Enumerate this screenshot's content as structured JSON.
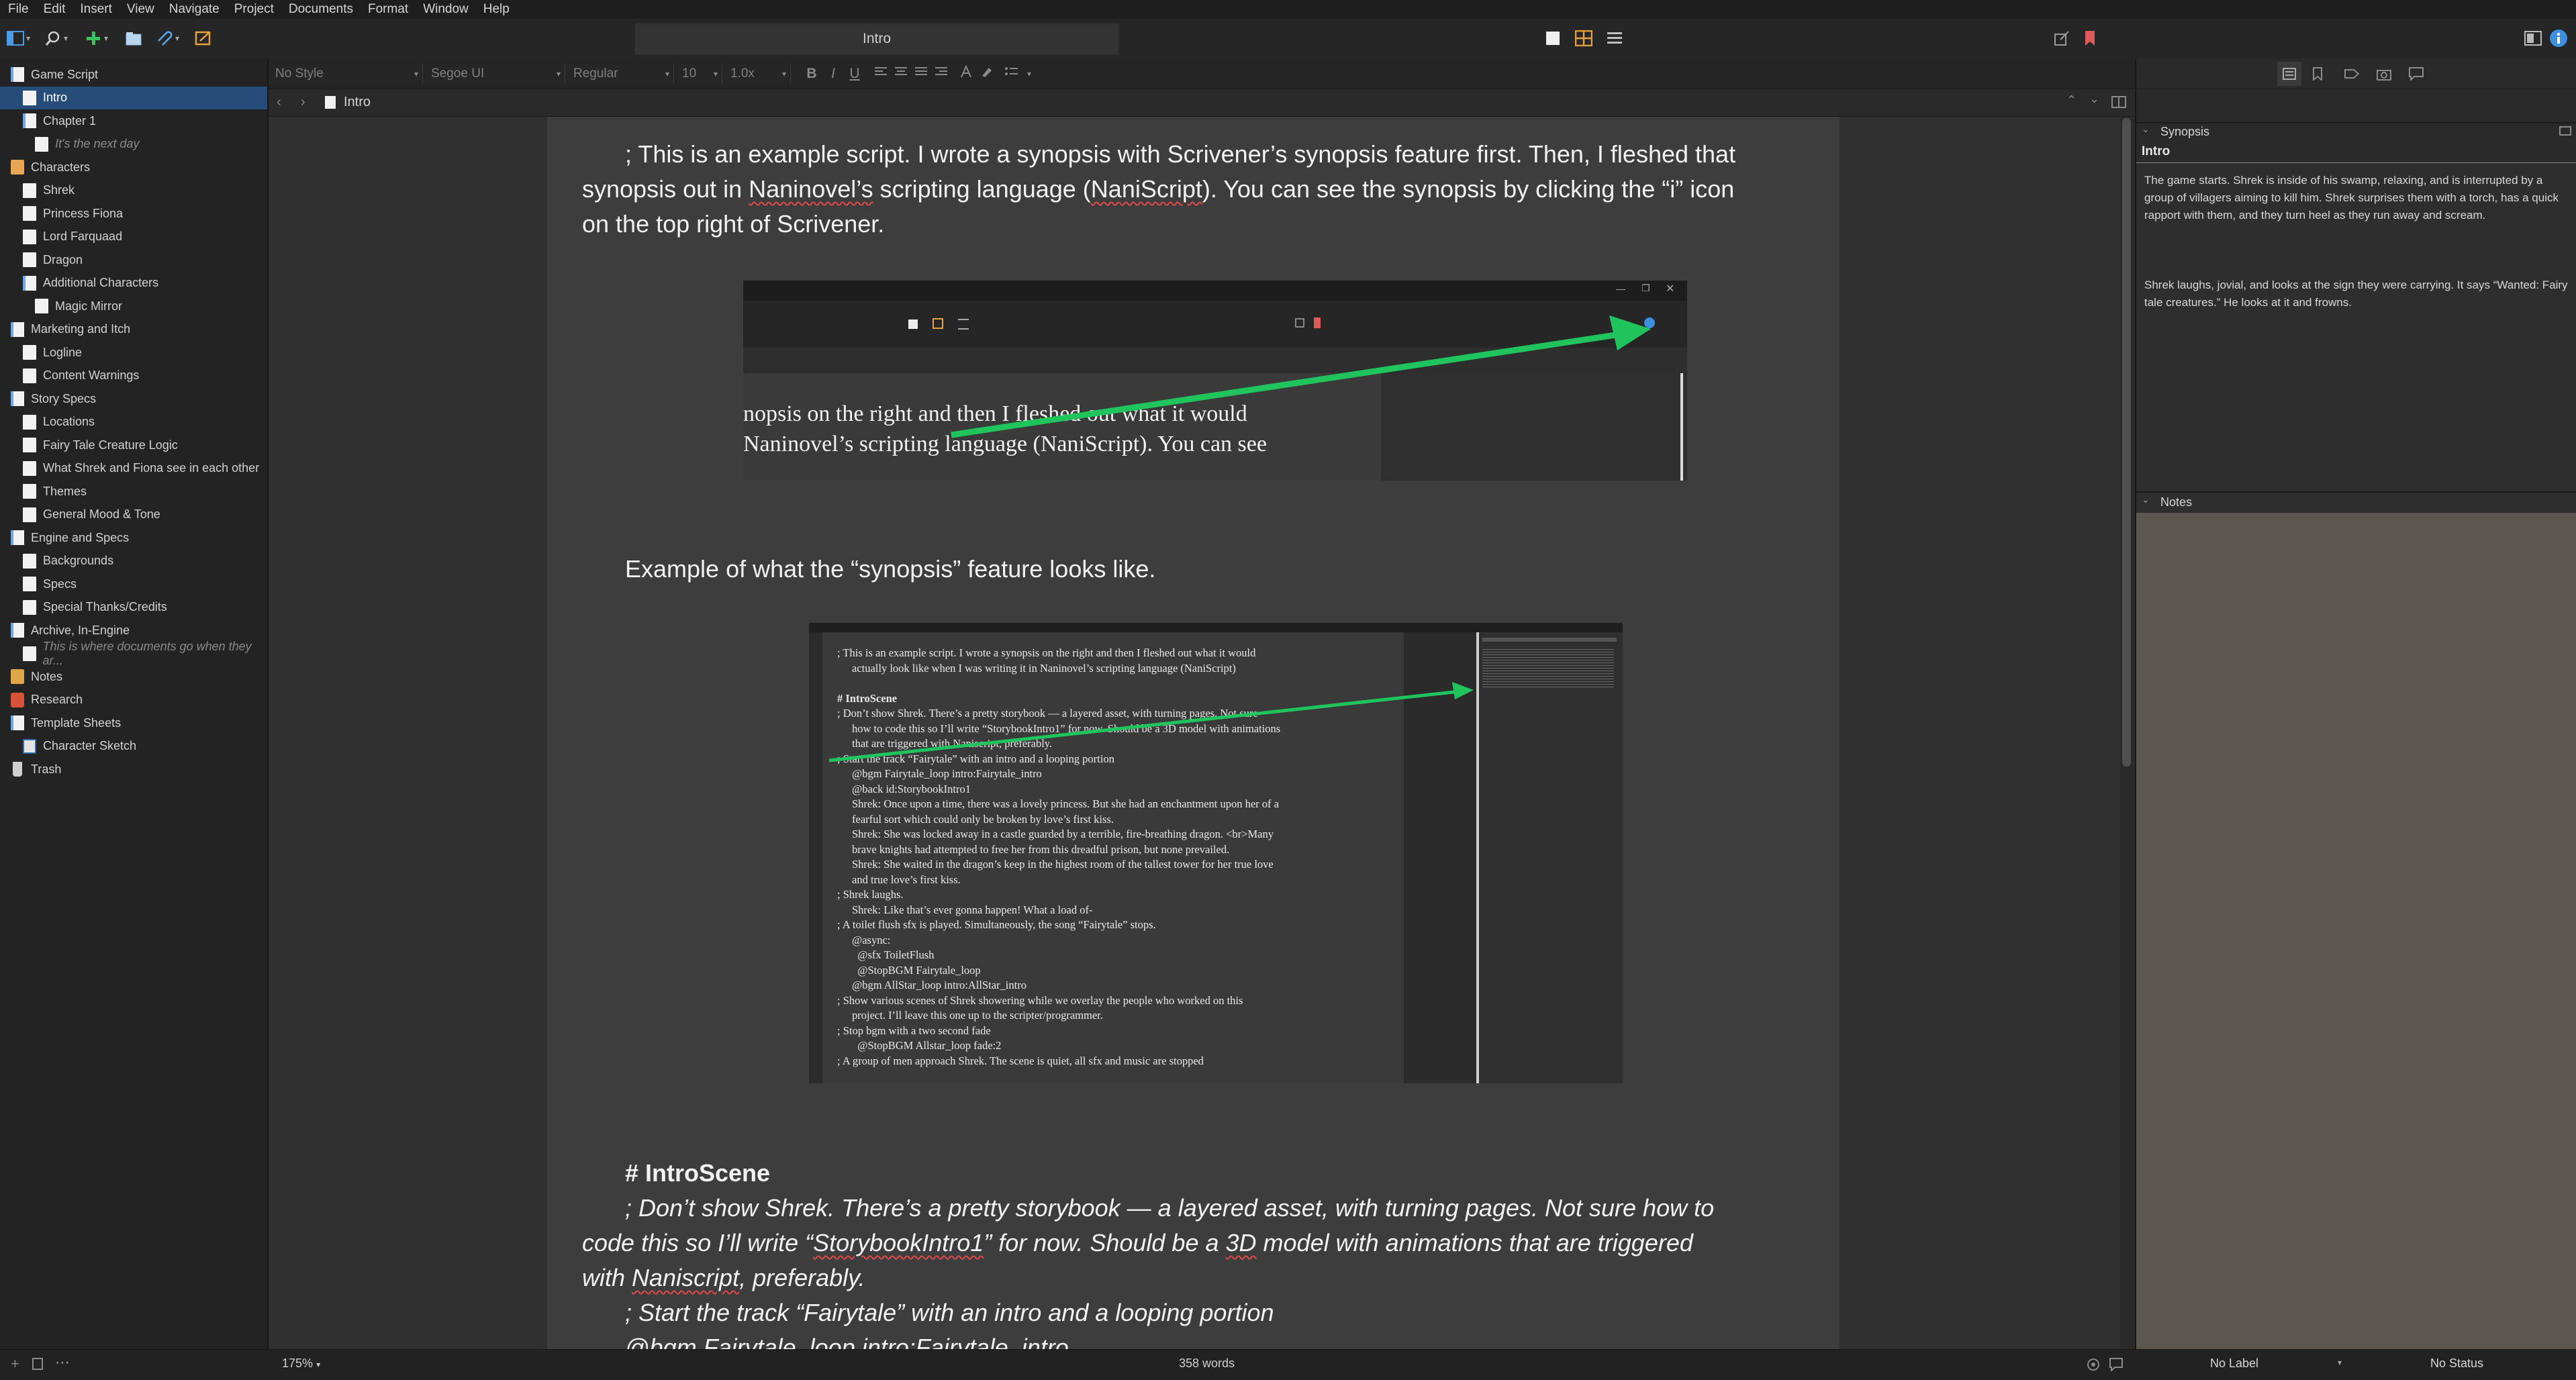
{
  "menu": [
    "File",
    "Edit",
    "Insert",
    "View",
    "Navigate",
    "Project",
    "Documents",
    "Format",
    "Window",
    "Help"
  ],
  "toolbar": {
    "document_title": "Intro",
    "icons": [
      "binder-toggle-icon",
      "search-icon",
      "add-icon",
      "folder-add-icon",
      "paperclip-icon",
      "quick-reference-icon",
      "editor-mode-icon",
      "corkboard-icon",
      "outliner-icon",
      "share-icon",
      "bookmark-icon",
      "compose-icon",
      "inspector-icon"
    ],
    "accent": "#e8a23a"
  },
  "format_bar": {
    "style": "No Style",
    "font": "Segoe UI",
    "weight": "Regular",
    "size": "10",
    "spacing": "1.0x",
    "buttons": [
      "B",
      "I",
      "U"
    ]
  },
  "binder": {
    "items": [
      {
        "label": "Game Script",
        "icon": "document-folder-icon",
        "level": 0,
        "selected": false
      },
      {
        "label": "Intro",
        "icon": "document-icon",
        "level": 1,
        "selected": true
      },
      {
        "label": "Chapter 1",
        "icon": "document-folder-icon",
        "level": 1,
        "selected": false
      },
      {
        "label": "It's the next day",
        "icon": "document-icon",
        "level": 2,
        "selected": false,
        "muted": true
      },
      {
        "label": "Characters",
        "icon": "characters-folder-icon",
        "level": 0,
        "selected": false
      },
      {
        "label": "Shrek",
        "icon": "document-icon",
        "level": 1,
        "selected": false
      },
      {
        "label": "Princess Fiona",
        "icon": "document-icon",
        "level": 1,
        "selected": false
      },
      {
        "label": "Lord Farquaad",
        "icon": "document-icon",
        "level": 1,
        "selected": false
      },
      {
        "label": "Dragon",
        "icon": "document-icon",
        "level": 1,
        "selected": false
      },
      {
        "label": "Additional Characters",
        "icon": "document-folder-icon",
        "level": 1,
        "selected": false
      },
      {
        "label": "Magic Mirror",
        "icon": "document-icon",
        "level": 2,
        "selected": false
      },
      {
        "label": "Marketing and Itch",
        "icon": "document-folder-icon",
        "level": 0,
        "selected": false
      },
      {
        "label": "Logline",
        "icon": "document-icon",
        "level": 1,
        "selected": false
      },
      {
        "label": "Content Warnings",
        "icon": "document-icon",
        "level": 1,
        "selected": false
      },
      {
        "label": "Story Specs",
        "icon": "document-folder-icon",
        "level": 0,
        "selected": false
      },
      {
        "label": "Locations",
        "icon": "document-icon",
        "level": 1,
        "selected": false
      },
      {
        "label": "Fairy Tale Creature Logic",
        "icon": "document-icon",
        "level": 1,
        "selected": false
      },
      {
        "label": "What Shrek and Fiona see in each other",
        "icon": "document-icon",
        "level": 1,
        "selected": false
      },
      {
        "label": "Themes",
        "icon": "document-icon",
        "level": 1,
        "selected": false
      },
      {
        "label": "General Mood & Tone",
        "icon": "document-icon",
        "level": 1,
        "selected": false
      },
      {
        "label": "Engine and Specs",
        "icon": "document-folder-icon",
        "level": 0,
        "selected": false
      },
      {
        "label": "Backgrounds",
        "icon": "document-icon",
        "level": 1,
        "selected": false
      },
      {
        "label": "Specs",
        "icon": "document-icon",
        "level": 1,
        "selected": false
      },
      {
        "label": "Special Thanks/Credits",
        "icon": "document-icon",
        "level": 1,
        "selected": false
      },
      {
        "label": "Archive, In-Engine",
        "icon": "document-folder-icon",
        "level": 0,
        "selected": false
      },
      {
        "label": "This is where documents go when they ar...",
        "icon": "document-icon",
        "level": 1,
        "selected": false,
        "muted": true
      },
      {
        "label": "Notes",
        "icon": "folder-icon",
        "level": 0,
        "selected": false
      },
      {
        "label": "Research",
        "icon": "research-icon",
        "level": 0,
        "selected": false
      },
      {
        "label": "Template Sheets",
        "icon": "document-folder-icon",
        "level": 0,
        "selected": false
      },
      {
        "label": "Character Sketch",
        "icon": "sheet-icon",
        "level": 1,
        "selected": false
      },
      {
        "label": "Trash",
        "icon": "trash-icon",
        "level": 0,
        "selected": false
      }
    ]
  },
  "editor_header": {
    "title": "Intro"
  },
  "document": {
    "p1": "; This is an example script. I wrote a synopsis with Scrivener’s synopsis feature first. Then, I fleshed that",
    "p1b_pre": "synopsis out in ",
    "p1b_sq": "Naninovel’s",
    "p1b_mid": " scripting language (",
    "p1b_sq2": "NaniScript",
    "p1b_post": "). You can see the synopsis by clicking the “i” icon",
    "p1c": "on the top right of Scrivener.",
    "img1_line1": "nopsis on the right and then I fleshed out what it would",
    "img1_line2": "Naninovel’s scripting language (NaniScript). You can see",
    "caption": "Example of what the “synopsis” feature looks like.",
    "img2_lines": [
      "; This is an example script. I wrote a synopsis on the right and then I fleshed out what it would",
      "actually look like when I was writing it in Naninovel’s scripting language (NaniScript)",
      "",
      "# IntroScene",
      "; Don’t show Shrek. There’s a pretty storybook — a layered asset, with turning pages. Not sure",
      "how to code this so I’ll write “StorybookIntro1” for now. Should be a 3D model with animations",
      "that are triggered with Naniscript, preferably.",
      "; Start the track “Fairytale” with an intro and a looping portion",
      "@bgm Fairytale_loop intro:Fairytale_intro",
      "@back id:StorybookIntro1",
      "Shrek: Once upon a time, there was a lovely princess. But she had an enchantment upon her of a",
      "fearful sort which could only be broken by love’s first kiss.",
      "Shrek: She was locked away in a castle guarded by a terrible, fire-breathing dragon. <br>Many",
      "brave knights had attempted to free her from this dreadful prison, but none prevailed.",
      "Shrek: She waited in the dragon’s keep in the highest room of the tallest tower for her true love",
      "and true love’s first kiss.",
      "; Shrek laughs.",
      "Shrek: Like that’s ever gonna happen! What a load of-",
      "; A toilet flush sfx is played. Simultaneously, the song “Fairytale” stops.",
      "@async:",
      "  @sfx ToiletFlush",
      "  @StopBGM Fairytale_loop",
      "@bgm AllStar_loop intro:AllStar_intro",
      "; Show various scenes of Shrek showering while we overlay the people who worked on this",
      "project. I’ll leave this one up to the scripter/programmer.",
      "; Stop bgm with a two second fade",
      "  @StopBGM Allstar_loop fade:2",
      "; A group of men approach Shrek. The scene is quiet, all sfx and music are stopped"
    ],
    "heading": "# IntroScene",
    "p3a_pre": "; Don’t show Shrek. There’s a pretty storybook — a layered asset, with turning pages. Not sure how to",
    "p3b_pre": "code this so I’ll write “",
    "p3b_sq": "StorybookIntro1",
    "p3b_post": "” for now. Should be a ",
    "p3b_sq2": "3D",
    "p3b_post2": " model with animations that are triggered",
    "p3c_pre": "with ",
    "p3c_sq": "Naniscript",
    "p3c_post": ", preferably.",
    "p4": "; Start the track “Fairytale” with an intro and a looping portion",
    "p5": "@bgm Fairytale_loop intro:Fairytale_intro"
  },
  "inspector": {
    "synopsis_header": "Synopsis",
    "synopsis_title": "Intro",
    "synopsis_text_1": "The game starts. Shrek is inside of his swamp, relaxing, and is interrupted by a group of villagers aiming to kill him. Shrek surprises them with a torch, has a quick rapport with them, and they turn heel as they run away and scream.",
    "synopsis_text_2": "Shrek laughs, jovial, and looks at the sign they were carrying. It says “Wanted: Fairy tale creatures.” He looks at it and frowns.",
    "notes_header": "Notes",
    "notes_bg": "#5b574f"
  },
  "status": {
    "zoom": "175%",
    "word_count": "358 words",
    "label": "No Label",
    "status": "No Status"
  }
}
